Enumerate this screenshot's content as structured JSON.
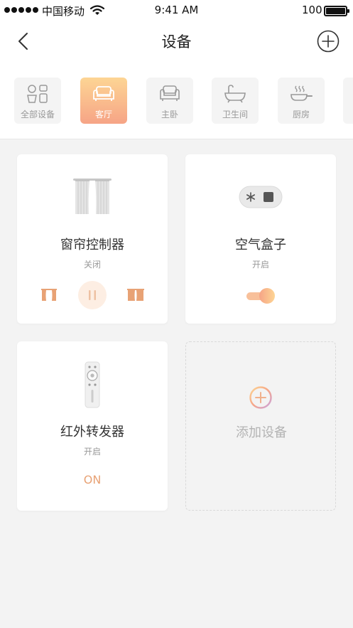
{
  "status_bar": {
    "carrier": "中国移动",
    "time": "9:41 AM",
    "battery": "100"
  },
  "nav": {
    "title": "设备",
    "back_icon": "chevron-left-icon",
    "add_icon": "plus-circle-icon"
  },
  "categories": [
    {
      "label": "全部设备",
      "icon": "all-devices-icon",
      "active": false
    },
    {
      "label": "客厅",
      "icon": "sofa-icon",
      "active": true
    },
    {
      "label": "主卧",
      "icon": "armchair-icon",
      "active": false
    },
    {
      "label": "卫生间",
      "icon": "bathtub-icon",
      "active": false
    },
    {
      "label": "厨房",
      "icon": "pan-icon",
      "active": false
    }
  ],
  "devices": [
    {
      "name": "窗帘控制器",
      "status": "关闭",
      "icon": "curtain-icon"
    },
    {
      "name": "空气盒子",
      "status": "开启",
      "icon": "air-box-icon"
    },
    {
      "name": "红外转发器",
      "status": "开启",
      "icon": "remote-icon",
      "action": "ON"
    }
  ],
  "add_device": {
    "label": "添加设备"
  },
  "colors": {
    "accent_start": "#fdd594",
    "accent_end": "#f6a486",
    "accent_text": "#e8a275",
    "background": "#f3f3f3"
  }
}
